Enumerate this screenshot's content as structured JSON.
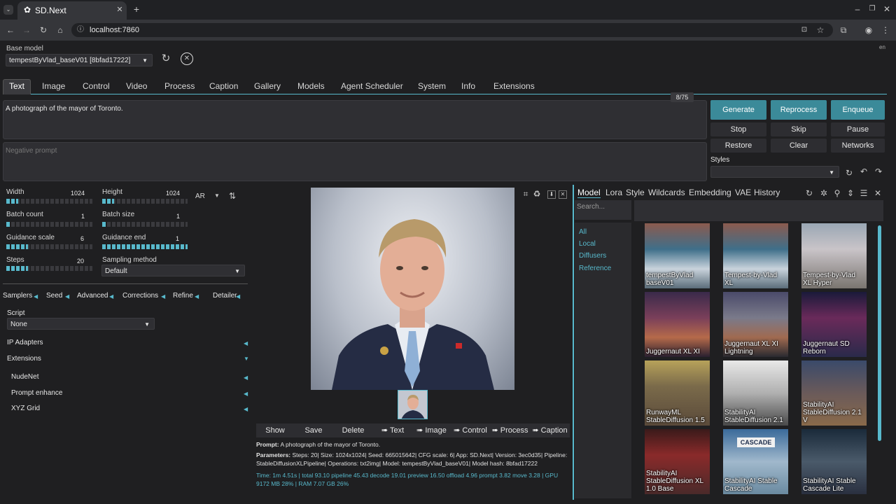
{
  "browser": {
    "tab_title": "SD.Next",
    "url": "localhost:7860"
  },
  "lang": "en",
  "base_model": {
    "label": "Base model",
    "value": "tempestByVlad_baseV01 [8bfad17222]"
  },
  "nav_tabs": [
    "Text",
    "Image",
    "Control",
    "Video",
    "Process",
    "Caption",
    "Gallery",
    "Models",
    "Agent Scheduler",
    "System",
    "Info",
    "Extensions"
  ],
  "prompt": {
    "value": "A photograph of the mayor of Toronto.",
    "token_count": "8/75",
    "negative_placeholder": "Negative prompt"
  },
  "actions": {
    "generate": "Generate",
    "reprocess": "Reprocess",
    "enqueue": "Enqueue",
    "stop": "Stop",
    "skip": "Skip",
    "pause": "Pause",
    "restore": "Restore",
    "clear": "Clear",
    "networks": "Networks",
    "styles_label": "Styles"
  },
  "params": {
    "width": {
      "label": "Width",
      "value": "1024",
      "fraction": 0.14
    },
    "height": {
      "label": "Height",
      "value": "1024",
      "fraction": 0.14
    },
    "ar": "AR",
    "batch_count": {
      "label": "Batch count",
      "value": "1",
      "fraction": 0.05
    },
    "batch_size": {
      "label": "Batch size",
      "value": "1",
      "fraction": 0.05
    },
    "guidance_scale": {
      "label": "Guidance scale",
      "value": "6",
      "fraction": 0.25
    },
    "guidance_end": {
      "label": "Guidance end",
      "value": "1",
      "fraction": 1.0
    },
    "steps": {
      "label": "Steps",
      "value": "20",
      "fraction": 0.25
    },
    "sampling_method": {
      "label": "Sampling method",
      "value": "Default"
    }
  },
  "sub_tabs": [
    "Samplers",
    "Seed",
    "Advanced",
    "Corrections",
    "Refine",
    "Detailer"
  ],
  "script": {
    "label": "Script",
    "value": "None"
  },
  "accordions": {
    "ip_adapters": "IP Adapters",
    "extensions": "Extensions",
    "nudenet": "NudeNet",
    "prompt_enhance": "Prompt enhance",
    "xyz_grid": "XYZ Grid"
  },
  "gallery_toolbar": [
    "Show",
    "Save",
    "Delete",
    "➠ Text",
    "➠ Image",
    "➠ Control",
    "➠ Process",
    "➠ Caption"
  ],
  "info": {
    "prompt_label": "Prompt:",
    "prompt_value": "A photograph of the mayor of Toronto.",
    "params_label": "Parameters:",
    "params_value": "Steps: 20| Size: 1024x1024| Seed: 665015642| CFG scale: 6| App: SD.Next| Version: 3ec0d35| Pipeline: StableDiffusionXLPipeline| Operations: txt2img| Model: tempestByVlad_baseV01| Model hash: 8bfad17222",
    "time": "Time: 1m 4.51s | total 93.10 pipeline 45.43 decode 19.01 preview 16.50 offload 4.96 prompt 3.82 move 3.28 | GPU 9172 MB 28% | RAM 7.07 GB 26%"
  },
  "networks": {
    "tabs": [
      "Model",
      "Lora",
      "Style",
      "Wildcards",
      "Embedding",
      "VAE",
      "History"
    ],
    "search_placeholder": "Search...",
    "categories": [
      "All",
      "Local",
      "Diffusers",
      "Reference"
    ],
    "cards": [
      "tempestByVlad baseV01",
      "Tempest-by-Vlad XL",
      "Tempest-by-Vlad XL Hyper",
      "Juggernaut XL XI",
      "Juggernaut XL XI Lightning",
      "Juggernaut SD Reborn",
      "RunwayML StableDiffusion 1.5",
      "StabilityAI StableDiffusion 2.1",
      "StabilityAI StableDiffusion 2.1 V",
      "StabilityAI StableDiffusion XL 1.0 Base",
      "StabilityAI Stable Cascade",
      "StabilityAI Stable Cascade Lite"
    ],
    "cascade_sign": "CASCADE"
  },
  "colors": {
    "accent": "#58b9cc",
    "primary_button": "#3b8a99",
    "background": "#1f1f21"
  }
}
